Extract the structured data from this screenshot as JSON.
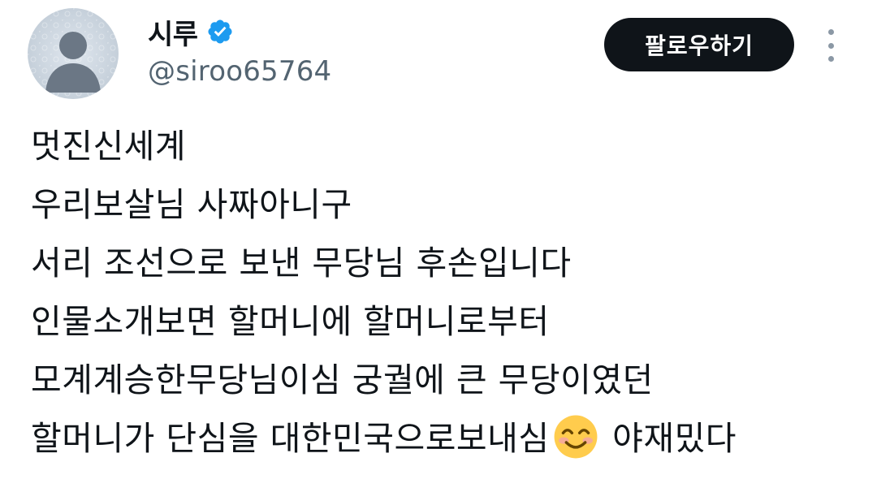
{
  "user": {
    "display_name": "시루",
    "handle": "@siroo65764",
    "verified": true
  },
  "actions": {
    "follow_label": "팔로우하기",
    "more_icon": "more-vertical-icon"
  },
  "tweet": {
    "lines": [
      "멋진신세계",
      "우리보살님 사짜아니구",
      "서리 조선으로 보낸 무당님 후손입니다",
      "인물소개보면 할머니에 할머니로부터",
      "모계계승한무당님이심 궁궐에 큰 무당이였던"
    ],
    "last_line_before_emoji": "할머니가 단심을 대한민국으로보내심",
    "emoji": "smiling-face-icon",
    "last_line_after_emoji": " 야재밌다"
  },
  "colors": {
    "text": "#0f1419",
    "secondary": "#536471",
    "verified": "#1d9bf0",
    "button_bg": "#0f1419",
    "button_text": "#ffffff"
  }
}
